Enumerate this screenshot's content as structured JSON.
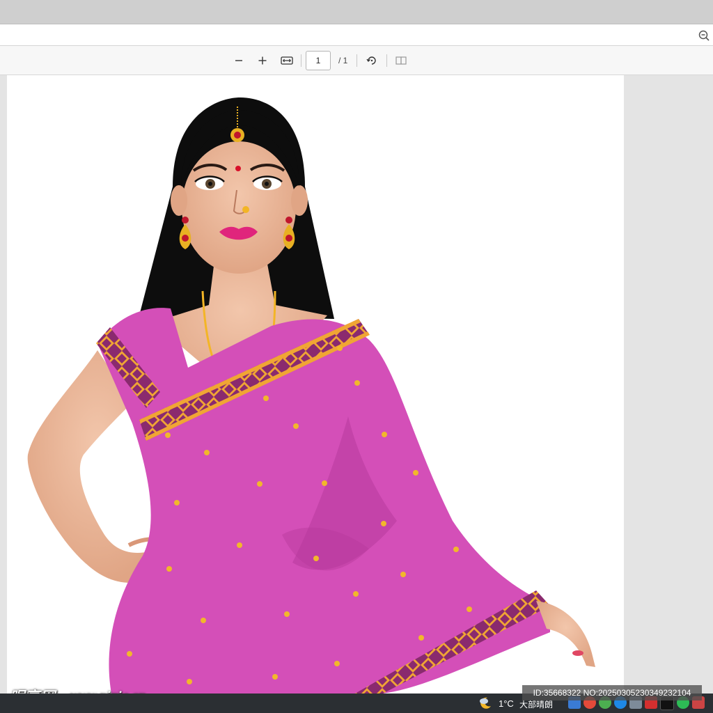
{
  "toolbar": {
    "zoom_out_icon": "minus-icon",
    "zoom_in_icon": "plus-icon",
    "fit_icon": "fit-width-icon",
    "page_value": "1",
    "page_total": "/ 1",
    "rotate_icon": "rotate-icon",
    "spread_icon": "two-page-icon"
  },
  "page": {
    "illustration": "woman in pink saree with gold jewelry"
  },
  "watermark": {
    "logo": "昵享网",
    "url": "www.nipic.cn",
    "id_text": "ID:35668322 NO:20250305230349232104"
  },
  "taskbar": {
    "weather_icon": "moon-cloud-icon",
    "temperature": "1°C",
    "weather_text": "大部晴朗",
    "tray_icons": [
      "network-icon",
      "app-icon",
      "browser-icon",
      "browser-icon",
      "cloud-icon",
      "shield-icon",
      "tiktok-icon",
      "wechat-icon",
      "avatar-icon"
    ]
  },
  "colors": {
    "saree": "#d44fb8",
    "border_gold": "#f0a534",
    "border_dark": "#8a2a6e",
    "skin": "#ecb89a",
    "hair": "#0d0d0d"
  }
}
